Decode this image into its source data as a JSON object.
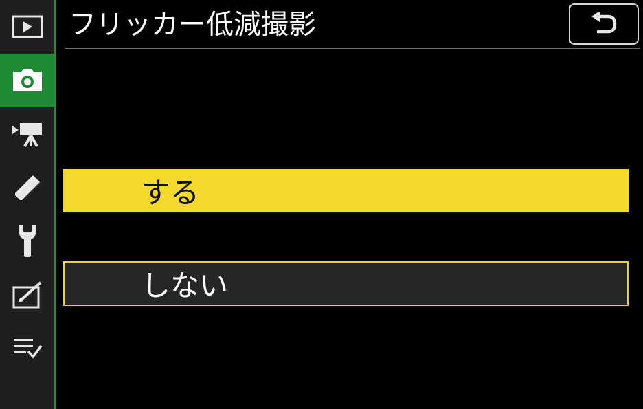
{
  "header": {
    "title": "フリッカー低減撮影",
    "back_icon": "return-arrow-icon"
  },
  "sidebar": {
    "accent_color": "#1e8a34",
    "items": [
      {
        "icon": "playback-icon",
        "active": false
      },
      {
        "icon": "camera-icon",
        "active": true
      },
      {
        "icon": "movie-camera-icon",
        "active": false
      },
      {
        "icon": "pencil-icon",
        "active": false
      },
      {
        "icon": "wrench-icon",
        "active": false
      },
      {
        "icon": "retouch-icon",
        "active": false
      },
      {
        "icon": "my-menu-icon",
        "active": false
      }
    ]
  },
  "options": [
    {
      "label": "する",
      "selected": true
    },
    {
      "label": "しない",
      "selected": false
    }
  ],
  "colors": {
    "highlight": "#f3d92a",
    "outline": "#e9d338",
    "background": "#000000"
  }
}
